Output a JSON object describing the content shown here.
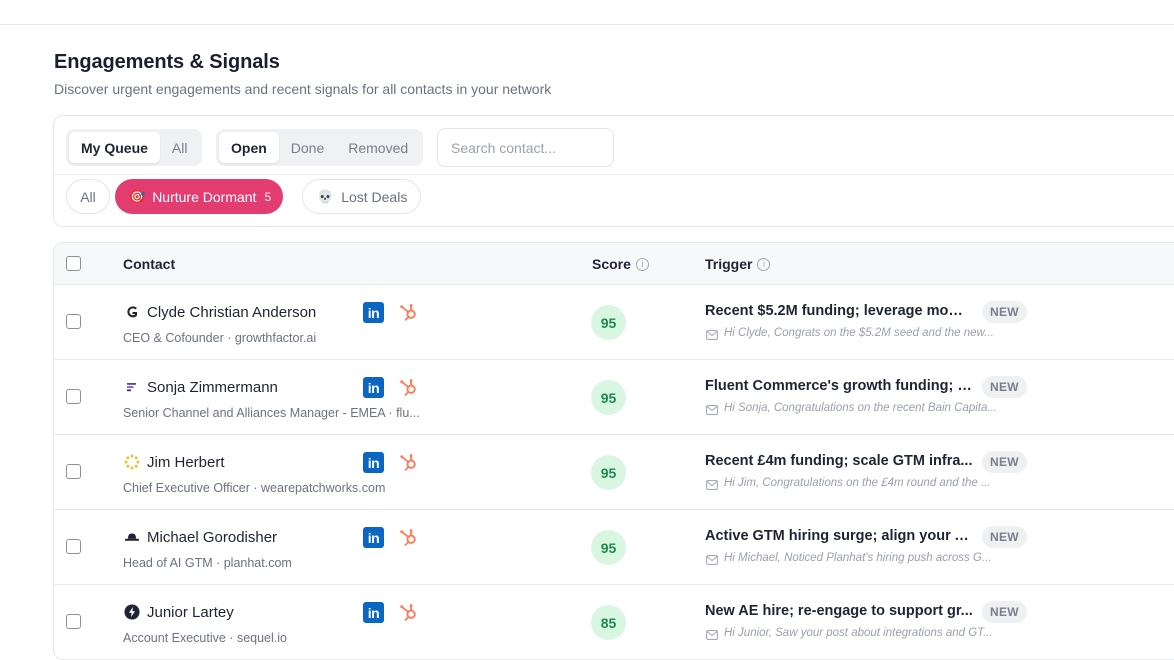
{
  "header": {
    "title": "Engagements & Signals",
    "subtitle": "Discover urgent engagements and recent signals for all contacts in your network"
  },
  "filters": {
    "queue_tabs": [
      {
        "label": "My Queue",
        "active": true
      },
      {
        "label": "All",
        "active": false
      }
    ],
    "status_tabs": [
      {
        "label": "Open",
        "active": true
      },
      {
        "label": "Done",
        "active": false
      },
      {
        "label": "Removed",
        "active": false
      }
    ],
    "search": {
      "placeholder": "Search contact...",
      "value": ""
    },
    "chips": {
      "all": {
        "label": "All"
      },
      "nurture": {
        "icon": "🎯",
        "label": "Nurture Dormant",
        "count": "5",
        "color": "#e23c71"
      },
      "lost": {
        "icon": "💀",
        "label": "Lost Deals"
      }
    }
  },
  "table": {
    "columns": {
      "contact": "Contact",
      "score": "Score",
      "trigger": "Trigger"
    },
    "info_glyph": "i",
    "rows": [
      {
        "logo_icon": "growthfactor-logo-icon",
        "name": "Clyde Christian Anderson",
        "role": "CEO & Cofounder · growthfactor.ai",
        "score": "95",
        "trigger": "Recent $5.2M funding; leverage mom...",
        "badge": "NEW",
        "message": "Hi Clyde, Congrats on the $5.2M seed and the new..."
      },
      {
        "logo_icon": "fluent-commerce-logo-icon",
        "name": "Sonja Zimmermann",
        "role": "Senior Channel and Alliances Manager - EMEA · flu...",
        "score": "95",
        "trigger": "Fluent Commerce's growth funding; a...",
        "badge": "NEW",
        "message": "Hi Sonja, Congratulations on the recent Bain Capita..."
      },
      {
        "logo_icon": "patchworks-logo-icon",
        "name": "Jim Herbert",
        "role": "Chief Executive Officer · wearepatchworks.com",
        "score": "95",
        "trigger": "Recent £4m funding; scale GTM infra...",
        "badge": "NEW",
        "message": "Hi Jim, Congratulations on the £4m round and the ..."
      },
      {
        "logo_icon": "planhat-logo-icon",
        "name": "Michael Gorodisher",
        "role": "Head of AI GTM · planhat.com",
        "score": "95",
        "trigger": "Active GTM hiring surge; align your A...",
        "badge": "NEW",
        "message": "Hi Michael, Noticed Planhat's hiring push across G..."
      },
      {
        "logo_icon": "sequel-logo-icon",
        "name": "Junior Lartey",
        "role": "Account Executive · sequel.io",
        "score": "85",
        "trigger": "New AE hire; re-engage to support gr...",
        "badge": "NEW",
        "message": "Hi Junior, Saw your post about integrations and GT..."
      }
    ],
    "linkedin_glyph": "in"
  },
  "colors": {
    "accent": "#e23c71",
    "linkedin": "#0a66c2",
    "hubspot": "#ff7a59",
    "score_bg": "#d9f6e3",
    "score_text": "#1e8a4c"
  }
}
